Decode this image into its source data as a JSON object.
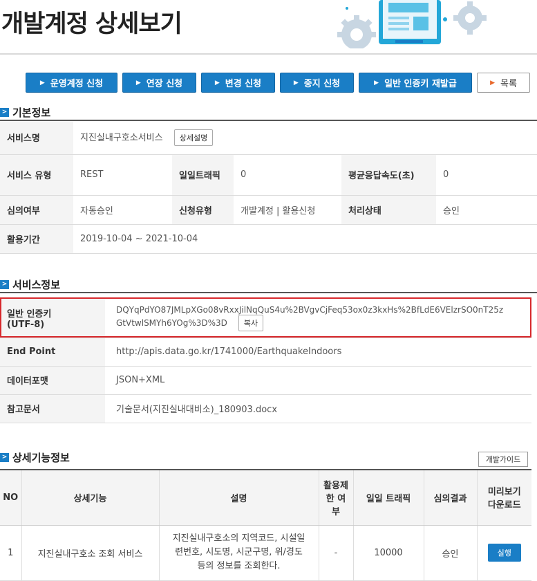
{
  "page": {
    "title": "개발계정 상세보기"
  },
  "toolbar": {
    "buttons": [
      {
        "label": "운영계정 신청"
      },
      {
        "label": "연장 신청"
      },
      {
        "label": "변경 신청"
      },
      {
        "label": "중지 신청"
      },
      {
        "label": "일반 인증키 재발급"
      }
    ],
    "list_label": "목록"
  },
  "basic": {
    "heading": "기본정보",
    "service_name_label": "서비스명",
    "service_name": "지진실내구호소서비스",
    "detail_btn": "상세설명",
    "service_type_label": "서비스 유형",
    "service_type": "REST",
    "daily_traffic_label": "일일트래픽",
    "daily_traffic": "0",
    "avg_resp_label": "평균응답속도(초)",
    "avg_resp": "0",
    "review_label": "심의여부",
    "review": "자동승인",
    "request_type_label": "신청유형",
    "request_type": "개발계정 | 활용신청",
    "status_label": "처리상태",
    "status": "승인",
    "period_label": "활용기간",
    "period": "2019-10-04 ~ 2021-10-04"
  },
  "service": {
    "heading": "서비스정보",
    "key_label_1": "일반 인증키",
    "key_label_2": "(UTF-8)",
    "key_line_1": "DQYqPdYO87JMLpXGo08vRxxJilNqQuS4u%2BVgvCjFeq53ox0z3kxHs%2BfLdE6VElzrSO0nT25z",
    "key_line_2": "GtVtwlSMYh6YOg%3D%3D",
    "copy_btn": "복사",
    "endpoint_label": "End Point",
    "endpoint": "http://apis.data.go.kr/1741000/EarthquakeIndoors",
    "format_label": "데이터포맷",
    "format": "JSON+XML",
    "doc_label": "참고문서",
    "doc": "기술문서(지진실내대비소)_180903.docx"
  },
  "detail": {
    "heading": "상세기능정보",
    "guide_btn": "개발가이드",
    "headers": {
      "no": "NO",
      "func": "상세기능",
      "desc": "설명",
      "limit_1": "활용제",
      "limit_2": "한 여",
      "limit_3": "부",
      "traffic": "일일 트래픽",
      "result": "심의결과",
      "preview_1": "미리보기",
      "preview_2": "다운로드"
    },
    "rows": [
      {
        "no": "1",
        "func": "지진실내구호소 조회 서비스",
        "desc_1": "지진실내구호소의 지역코드, 시설일",
        "desc_2": "련번호, 시도명, 시군구명, 위/경도",
        "desc_3": "등의 정보를 조회한다.",
        "limit": "-",
        "traffic": "10000",
        "result": "승인",
        "run_btn": "실행"
      }
    ]
  }
}
